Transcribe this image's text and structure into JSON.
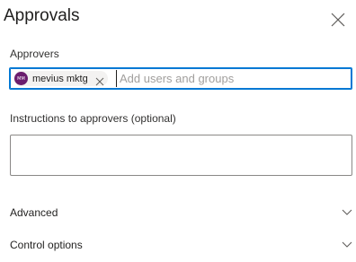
{
  "panel": {
    "title": "Approvals"
  },
  "approvers": {
    "label": "Approvers",
    "selected": [
      {
        "avatar_initials": "MM",
        "avatar_color": "#6b1d6e",
        "name": "mevius mktg"
      }
    ],
    "placeholder": "Add users and groups",
    "value": ""
  },
  "instructions": {
    "label": "Instructions to approvers (optional)",
    "value": ""
  },
  "sections": {
    "advanced": {
      "label": "Advanced"
    },
    "control_options": {
      "label": "Control options"
    }
  },
  "colors": {
    "focus_border": "#0078d4",
    "text": "#201f1e",
    "placeholder": "#a19f9d"
  }
}
